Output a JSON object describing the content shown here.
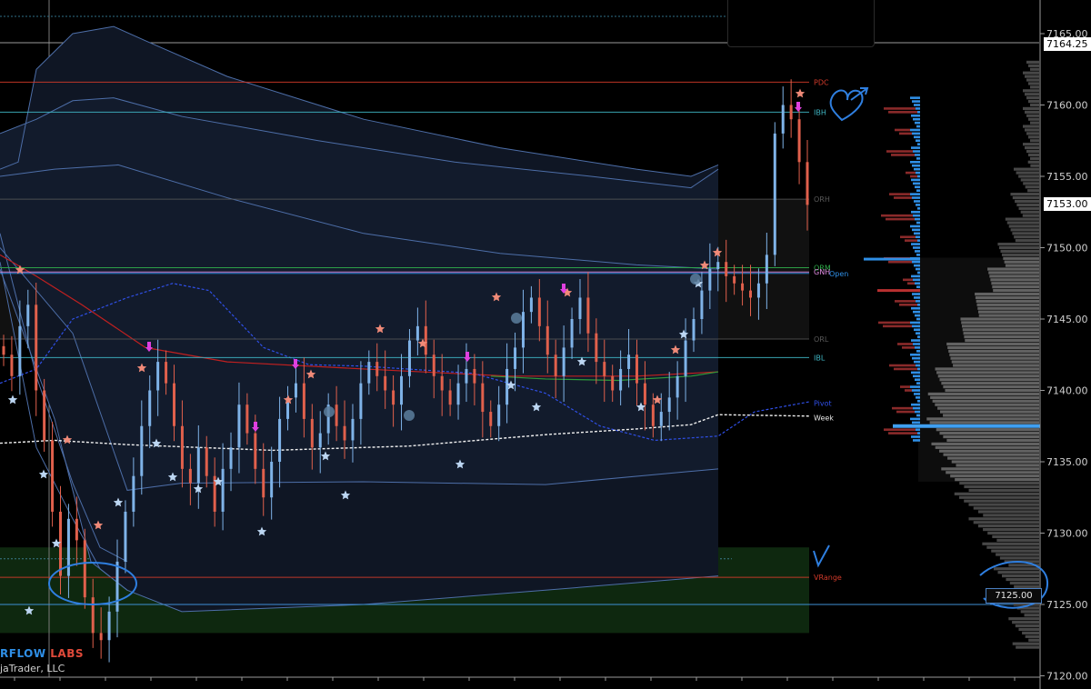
{
  "brand": {
    "part1": "RFLOW",
    "part2": " LABS",
    "copyright": "jaTrader, LLC"
  },
  "axis": {
    "ticks": [
      "7165.00",
      "7160.00",
      "7155.00",
      "7150.00",
      "7145.00",
      "7140.00",
      "7135.00",
      "7130.00",
      "7125.00",
      "7120.00"
    ],
    "highlight_top": "7164.25",
    "highlight_last": "7153.00",
    "cursor_price": "7125.00"
  },
  "levels": [
    {
      "name": "PDC",
      "label": "PDC",
      "price": 7161.6,
      "color": "#d23a2a"
    },
    {
      "name": "IBH",
      "label": "IBH",
      "price": 7159.5,
      "color": "#3fb6c4"
    },
    {
      "name": "ORH",
      "label": "ORH",
      "price": 7153.4,
      "color": "#5a5a5a"
    },
    {
      "name": "ORM",
      "label": "ORM",
      "price": 7148.6,
      "color": "#2fae4a"
    },
    {
      "name": "GNH",
      "label": "GNH",
      "price": 7148.3,
      "color": "#e08ae0"
    },
    {
      "name": "Open",
      "label": "Open",
      "price": 7148.2,
      "color": "#2f8fe6"
    },
    {
      "name": "ORL",
      "label": "ORL",
      "price": 7143.6,
      "color": "#5a5a5a"
    },
    {
      "name": "IBL",
      "label": "IBL",
      "price": 7142.3,
      "color": "#3fb6c4"
    },
    {
      "name": "Pivot",
      "label": "Pivot",
      "price": 7139.1,
      "color": "#2f4fe6"
    },
    {
      "name": "Week",
      "label": "Week",
      "price": 7138.1,
      "color": "#e6e6e6"
    },
    {
      "name": "VRange",
      "label": "VRange",
      "price": 7126.9,
      "color": "#d23a2a"
    }
  ],
  "chart_data": {
    "type": "candlestick",
    "ylim": [
      7120,
      7166.5
    ],
    "y_ticks": [
      7120,
      7125,
      7130,
      7135,
      7140,
      7145,
      7150,
      7155,
      7160,
      7165
    ],
    "last_price": 7153.0,
    "session_high": 7164.25,
    "close_series": [
      7142.5,
      7141.0,
      7144.5,
      7146.0,
      7140.0,
      7136.5,
      7131.5,
      7127.0,
      7131.0,
      7129.5,
      7125.5,
      7123.0,
      7122.5,
      7124.5,
      7128.0,
      7131.5,
      7134.0,
      7137.5,
      7140.0,
      7142.0,
      7140.5,
      7137.5,
      7134.5,
      7133.5,
      7136.0,
      7134.0,
      7131.5,
      7134.5,
      7136.0,
      7139.0,
      7137.0,
      7134.5,
      7132.5,
      7135.0,
      7138.0,
      7139.5,
      7140.5,
      7138.0,
      7136.0,
      7137.0,
      7139.0,
      7137.5,
      7136.5,
      7138.0,
      7140.5,
      7142.0,
      7141.0,
      7140.0,
      7139.0,
      7141.0,
      7143.5,
      7144.5,
      7142.5,
      7141.0,
      7140.0,
      7139.0,
      7140.5,
      7141.5,
      7140.5,
      7138.5,
      7137.5,
      7139.0,
      7141.5,
      7143.0,
      7145.5,
      7146.5,
      7144.5,
      7142.5,
      7141.0,
      7143.0,
      7145.0,
      7146.5,
      7144.0,
      7142.0,
      7141.0,
      7140.0,
      7141.5,
      7142.5,
      7140.5,
      7139.0,
      7137.5,
      7138.5,
      7139.5,
      7141.0,
      7143.5,
      7145.0,
      7147.0,
      7148.5,
      7149.0,
      7148.0,
      7147.5,
      7147.0,
      7146.5,
      7147.5,
      7149.5,
      7158.0,
      7160.0,
      7159.0,
      7156.0,
      7153.0
    ],
    "volume_profile": {
      "poc": 7137.5,
      "value_area_high": 7149.3,
      "value_area_low": 7133.6
    }
  }
}
